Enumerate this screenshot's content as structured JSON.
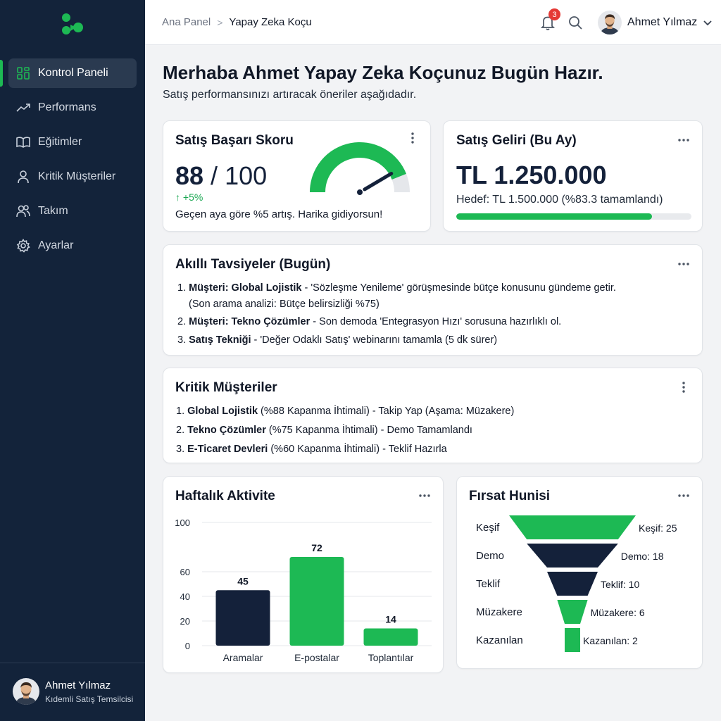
{
  "sidebar": {
    "items": [
      {
        "label": "Kontrol Paneli",
        "icon": "dashboard-icon",
        "active": true
      },
      {
        "label": "Performans",
        "icon": "trend-icon"
      },
      {
        "label": "Eğitimler",
        "icon": "book-icon"
      },
      {
        "label": "Kritik Müşteriler",
        "icon": "user-icon"
      },
      {
        "label": "Takım",
        "icon": "team-icon"
      },
      {
        "label": "Ayarlar",
        "icon": "gear-icon"
      }
    ],
    "user": {
      "name": "Ahmet Yılmaz",
      "role": "Kıdemli Satış Temsilcisi"
    }
  },
  "topbar": {
    "breadcrumb_home": "Ana Panel",
    "breadcrumb_current": "Yapay Zeka Koçu",
    "notification_count": "3",
    "user_name": "Ahmet Yılmaz"
  },
  "main": {
    "greeting": "Merhaba Ahmet Yapay Zeka Koçunuz Bugün Hazır.",
    "subtitle": "Satış performansınızı artıracak öneriler aşağıdadır."
  },
  "score_card": {
    "title": "Satış Başarı Skoru",
    "score": "88",
    "max": "100",
    "delta": "↑ +5%",
    "note": "Geçen aya göre %5 artış. Harika gidiyorsun!",
    "gauge_fraction": 0.88
  },
  "revenue_card": {
    "title": "Satış Geliri (Bu Ay)",
    "value": "TL 1.250.000",
    "target": "Hedef: TL 1.500.000 (%83.3 tamamlandı)",
    "progress_percent": 83.3
  },
  "advice_card": {
    "title": "Akıllı Tavsiyeler (Bugün)",
    "items": [
      {
        "num": "1.",
        "bold": "Müşteri: Global Lojistik",
        "text": " - 'Sözleşme Yenileme' görüşmesinde bütçe konusunu gündeme getir.",
        "sub": "(Son arama analizi: Bütçe belirsizliği %75)"
      },
      {
        "num": "2.",
        "bold": "Müşteri: Tekno Çözümler",
        "text": " - Son demoda 'Entegrasyon Hızı' sorusuna hazırlıklı ol."
      },
      {
        "num": "3.",
        "bold": "Satış Tekniği",
        "text": " - 'Değer Odaklı Satış' webinarını tamamla (5 dk sürer)"
      }
    ]
  },
  "critical_card": {
    "title": "Kritik Müşteriler",
    "items": [
      {
        "num": "1.",
        "bold": "Global Lojistik",
        "text": " (%88 Kapanma İhtimali) - Takip Yap (Aşama: Müzakere)"
      },
      {
        "num": "2.",
        "bold": "Tekno Çözümler",
        "text": " (%75 Kapanma İhtimali) - Demo Tamamlandı"
      },
      {
        "num": "3.",
        "bold": "E-Ticaret Devleri",
        "text": " (%60 Kapanma İhtimali) - Teklif Hazırla"
      }
    ]
  },
  "colors": {
    "accent": "#1db954",
    "navy": "#14213a",
    "sidebar": "#13233a"
  },
  "chart_data": [
    {
      "type": "bar",
      "title": "Haftalık Aktivite",
      "categories": [
        "Aramalar",
        "E-postalar",
        "Toplantılar"
      ],
      "values": [
        45,
        72,
        14
      ],
      "colors": [
        "#14213a",
        "#1db954",
        "#1db954"
      ],
      "yticks": [
        "100",
        "60",
        "40",
        "20",
        "0"
      ],
      "ylim": [
        0,
        100
      ],
      "grid": true
    },
    {
      "type": "funnel",
      "title": "Fırsat Hunisi",
      "stages": [
        "Keşif",
        "Demo",
        "Teklif",
        "Müzakere",
        "Kazanılan"
      ],
      "values": [
        25,
        18,
        10,
        6,
        2
      ],
      "value_labels": [
        "Keşif: 25",
        "Demo: 18",
        "Teklif: 10",
        "Müzakere: 6",
        "Kazanılan: 2"
      ],
      "colors": [
        "#1db954",
        "#14213a",
        "#14213a",
        "#1db954",
        "#1db954"
      ]
    }
  ]
}
